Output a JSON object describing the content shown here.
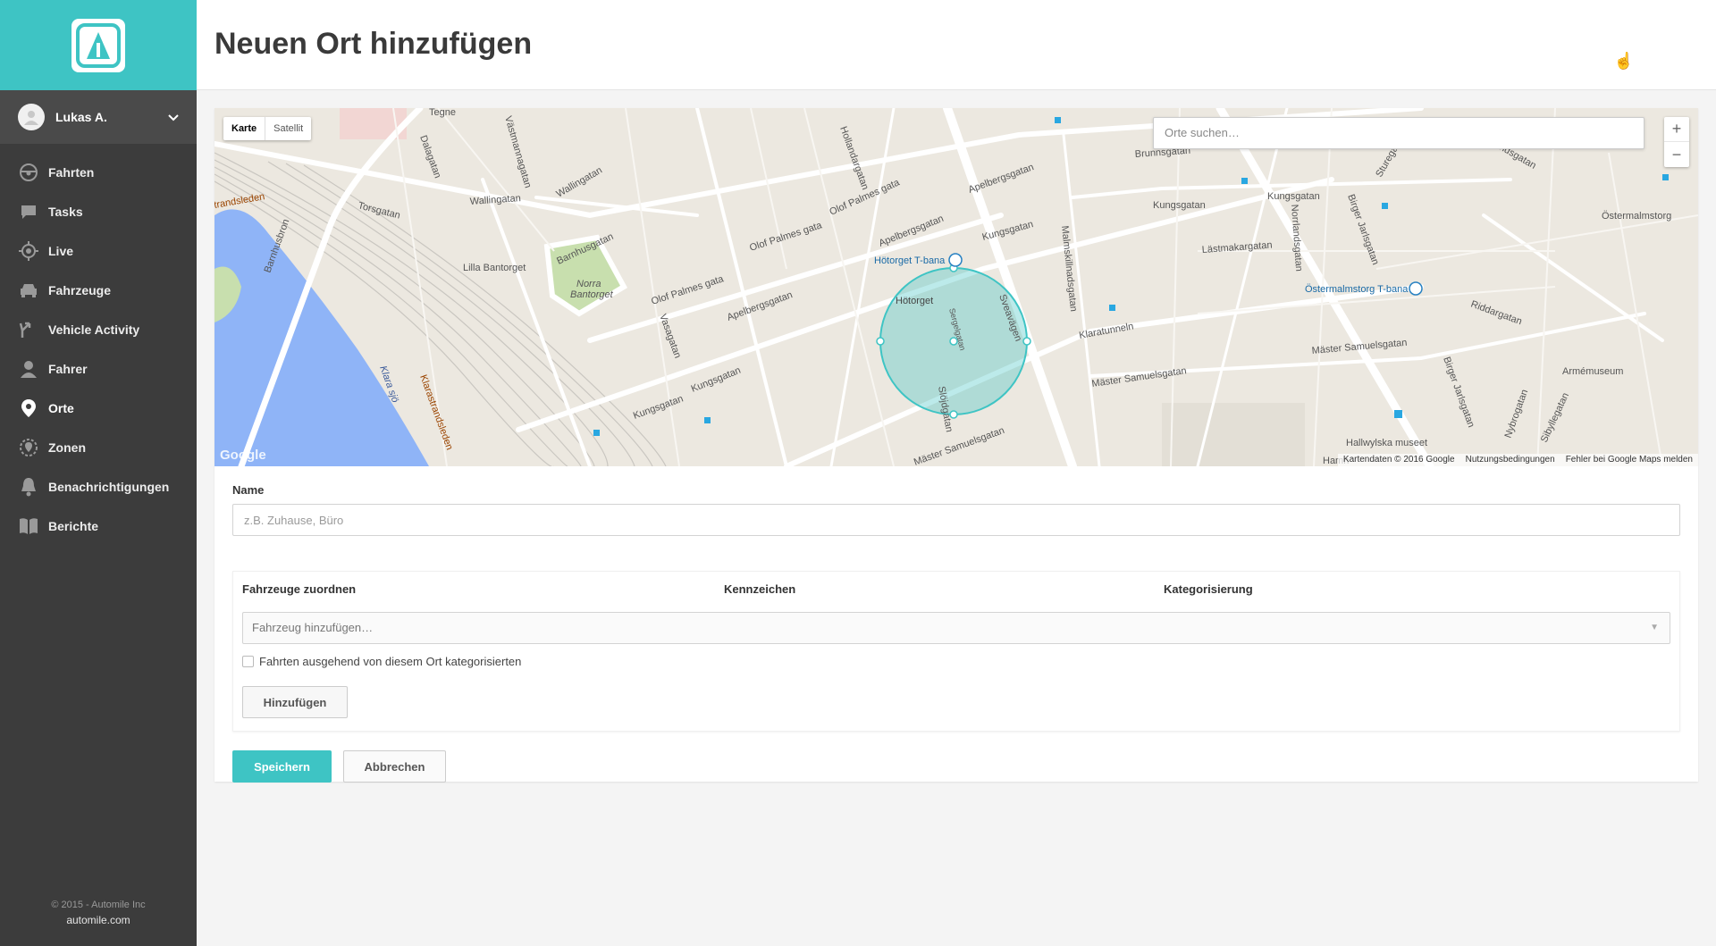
{
  "sidebar": {
    "user_name": "Lukas A.",
    "nav": [
      {
        "label": "Fahrten",
        "icon": "steering-wheel-icon"
      },
      {
        "label": "Tasks",
        "icon": "chat-icon"
      },
      {
        "label": "Live",
        "icon": "crosshair-icon"
      },
      {
        "label": "Fahrzeuge",
        "icon": "car-icon"
      },
      {
        "label": "Vehicle Activity",
        "icon": "split-arrow-icon"
      },
      {
        "label": "Fahrer",
        "icon": "person-icon"
      },
      {
        "label": "Orte",
        "icon": "map-pin-icon",
        "active": true
      },
      {
        "label": "Zonen",
        "icon": "zone-icon"
      },
      {
        "label": "Benachrichtigungen",
        "icon": "bell-icon"
      },
      {
        "label": "Berichte",
        "icon": "book-icon"
      }
    ],
    "footer_copyright": "© 2015 - Automile Inc",
    "footer_site": "automile.com"
  },
  "header": {
    "title": "Neuen Ort hinzufügen"
  },
  "map": {
    "type_map": "Karte",
    "type_satellite": "Satellit",
    "search_placeholder": "Orte suchen…",
    "zoom_in": "+",
    "zoom_out": "−",
    "footer": {
      "data": "Kartendaten © 2016 Google",
      "terms": "Nutzungsbedingungen",
      "report": "Fehler bei Google Maps melden"
    },
    "watermark": "Google",
    "labels": {
      "tegne": "Tegne",
      "dalagatan": "Dalagatan",
      "vastmannagatan": "Västmannagatan",
      "hollandargatan": "Hollandargatan",
      "torsgatan": "Torsgatan",
      "wallingatan_a": "Wallingatan",
      "wallingatan_b": "Wallingatan",
      "barnhusbron": "Barnhusbron",
      "lilla_bantorget": "Lilla Bantorget",
      "barnhusgatan": "Barnhusgatan",
      "norra": "Norra",
      "bantorget": "Bantorget",
      "olof_palmes_a": "Olof Palmes gata",
      "olof_palmes_b": "Olof Palmes gata",
      "olof_palmes_c": "Olof Palmes gata",
      "apelbergsgatan_a": "Apelbergsgatan",
      "apelbergsgatan_b": "Apelbergsgatan",
      "apelbergsgatan_c": "Apelbergsgatan",
      "hotorget_tbana": "Hötorget T-bana",
      "hotorget": "Hötorget",
      "kungsgatan_a": "Kungsgatan",
      "kungsgatan_b": "Kungsgatan",
      "kungsgatan_c": "Kungsgatan",
      "kungsgatan_d": "Kungsgatan",
      "kungsgatan_e": "Kungsgatan",
      "sveavagen": "Sveavägen",
      "malmskillnadsgatan": "Malmskillnadsgatan",
      "lastmakargatan": "Lästmakargatan",
      "norrlandsgatan": "Norrlandsgatan",
      "birger_jarlsgatan_a": "Birger Jarlsgatan",
      "birger_jarlsgatan_b": "Birger Jarlsgatan",
      "ostermalmstorg_tbana": "Östermalmstorg T-bana",
      "ostermalmstorg": "Östermalmstorg",
      "brunnsgatan": "Brunnsgatan",
      "klaratunneln": "Klaratunneln",
      "master_samuelsgatan_a": "Mäster Samuelsgatan",
      "master_samuelsgatan_b": "Mäster Samuelsgatan",
      "master_samuelsgatan_c": "Mäster Samuelsgatan",
      "riddargatan": "Riddargatan",
      "armemuseum": "Armémuseum",
      "hallwylska": "Hallwylska museet",
      "sibyllegatan": "Sibyllegatan",
      "nybrogatan": "Nybrogatan",
      "vasagatan": "Vasagatan",
      "klarastrandsleden": "Klarastrandsleden",
      "klara_sjo": "Klara sjö",
      "sergelgatan": "Sergelgatan",
      "slojdgatan": "Slöjdgatan",
      "strandsleden": "trandsleden",
      "smalandsgatan": "Smålandsgatan",
      "sturegatan": "Sturegatan",
      "hamn": "Hamn"
    }
  },
  "form": {
    "name_label": "Name",
    "name_placeholder": "z.B. Zuhause, Büro",
    "name_value": "",
    "col_assign": "Fahrzeuge zuordnen",
    "col_plate": "Kennzeichen",
    "col_category": "Kategorisierung",
    "vehicle_select_placeholder": "Fahrzeug hinzufügen…",
    "checkbox_label": "Fahrten ausgehend von diesem Ort kategorisierten",
    "add_button": "Hinzufügen",
    "save_button": "Speichern",
    "cancel_button": "Abbrechen"
  },
  "colors": {
    "accent": "#3ec4c4",
    "sidebar": "#3c3c3c",
    "water": "#8fb4f7",
    "park": "#c8dfae"
  }
}
